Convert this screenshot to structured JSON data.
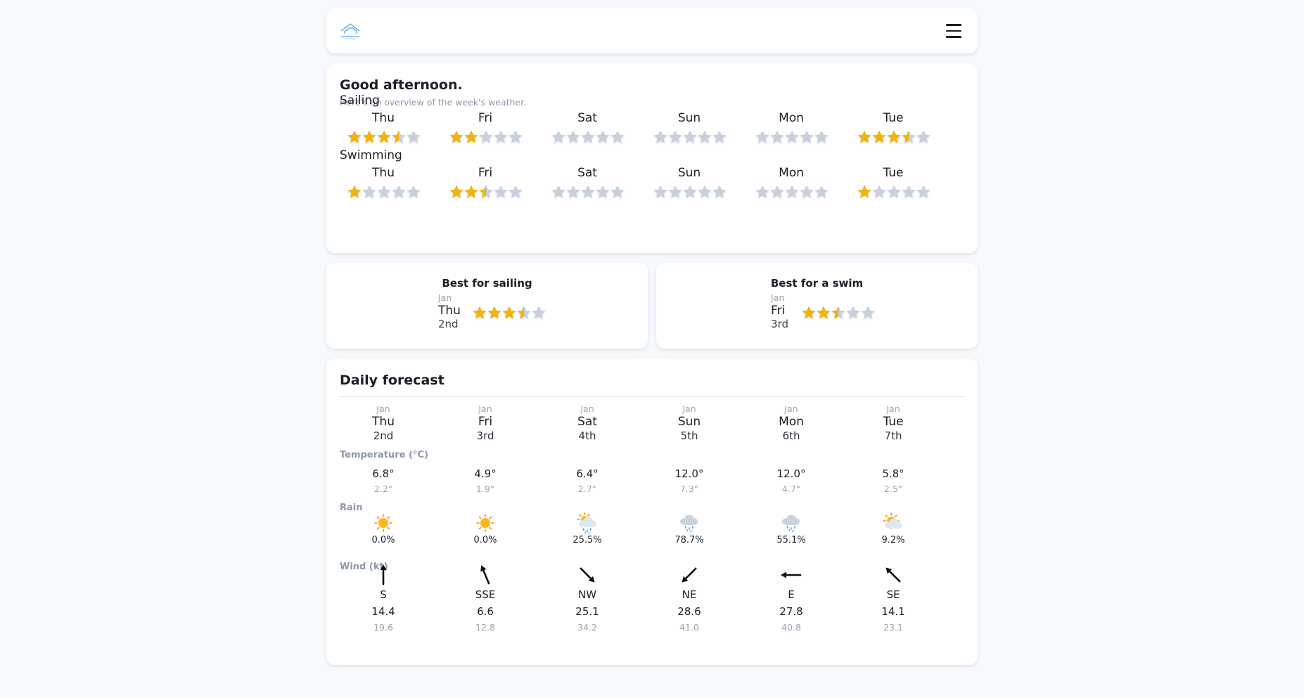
{
  "colors": {
    "star_on": "#efb412",
    "star_off": "#c6d0de",
    "arrow": "#111111"
  },
  "header": {
    "logo_icon": "cloud-house-icon",
    "menu_icon": "hamburger-menu-icon"
  },
  "overview": {
    "greeting": "Good afternoon.",
    "subtitle": "Here's an overview of the week's weather.",
    "activities": [
      {
        "title": "Sailing",
        "days": [
          {
            "day": "Thu",
            "rating": 3.5
          },
          {
            "day": "Fri",
            "rating": 2
          },
          {
            "day": "Sat",
            "rating": 0
          },
          {
            "day": "Sun",
            "rating": 0
          },
          {
            "day": "Mon",
            "rating": 0
          },
          {
            "day": "Tue",
            "rating": 3.5
          }
        ]
      },
      {
        "title": "Swimming",
        "days": [
          {
            "day": "Thu",
            "rating": 1
          },
          {
            "day": "Fri",
            "rating": 2.5
          },
          {
            "day": "Sat",
            "rating": 0
          },
          {
            "day": "Sun",
            "rating": 0
          },
          {
            "day": "Mon",
            "rating": 0
          },
          {
            "day": "Tue",
            "rating": 1
          }
        ]
      }
    ]
  },
  "best": [
    {
      "title": "Best for sailing",
      "month": "Jan",
      "day": "Thu",
      "date": "2nd",
      "rating": 3.5
    },
    {
      "title": "Best for a swim",
      "month": "Jan",
      "day": "Fri",
      "date": "3rd",
      "rating": 2.5
    }
  ],
  "daily": {
    "title": "Daily forecast",
    "temperature_label": "Temperature (°C)",
    "rain_label": "Rain",
    "wind_label": "Wind (kt)",
    "days": [
      {
        "month": "Jan",
        "day": "Thu",
        "date": "2nd",
        "tmax": "6.8°",
        "tmin": "2.2°",
        "rain_icon": "sun",
        "rain": "0.0%",
        "wind_dir": "S",
        "wind_deg": 180,
        "wind": "14.4",
        "gust": "19.6"
      },
      {
        "month": "Jan",
        "day": "Fri",
        "date": "3rd",
        "tmax": "4.9°",
        "tmin": "1.9°",
        "rain_icon": "sun",
        "rain": "0.0%",
        "wind_dir": "SSE",
        "wind_deg": 157.5,
        "wind": "6.6",
        "gust": "12.8"
      },
      {
        "month": "Jan",
        "day": "Sat",
        "date": "4th",
        "tmax": "6.4°",
        "tmin": "2.7°",
        "rain_icon": "sun-cloud-rain",
        "rain": "25.5%",
        "wind_dir": "NW",
        "wind_deg": 315,
        "wind": "25.1",
        "gust": "34.2"
      },
      {
        "month": "Jan",
        "day": "Sun",
        "date": "5th",
        "tmax": "12.0°",
        "tmin": "7.3°",
        "rain_icon": "cloud-rain",
        "rain": "78.7%",
        "wind_dir": "NE",
        "wind_deg": 45,
        "wind": "28.6",
        "gust": "41.0"
      },
      {
        "month": "Jan",
        "day": "Mon",
        "date": "6th",
        "tmax": "12.0°",
        "tmin": "4.7°",
        "rain_icon": "cloud-rain",
        "rain": "55.1%",
        "wind_dir": "E",
        "wind_deg": 90,
        "wind": "27.8",
        "gust": "40.8"
      },
      {
        "month": "Jan",
        "day": "Tue",
        "date": "7th",
        "tmax": "5.8°",
        "tmin": "2.5°",
        "rain_icon": "sun-cloud",
        "rain": "9.2%",
        "wind_dir": "SE",
        "wind_deg": 135,
        "wind": "14.1",
        "gust": "23.1"
      }
    ]
  }
}
